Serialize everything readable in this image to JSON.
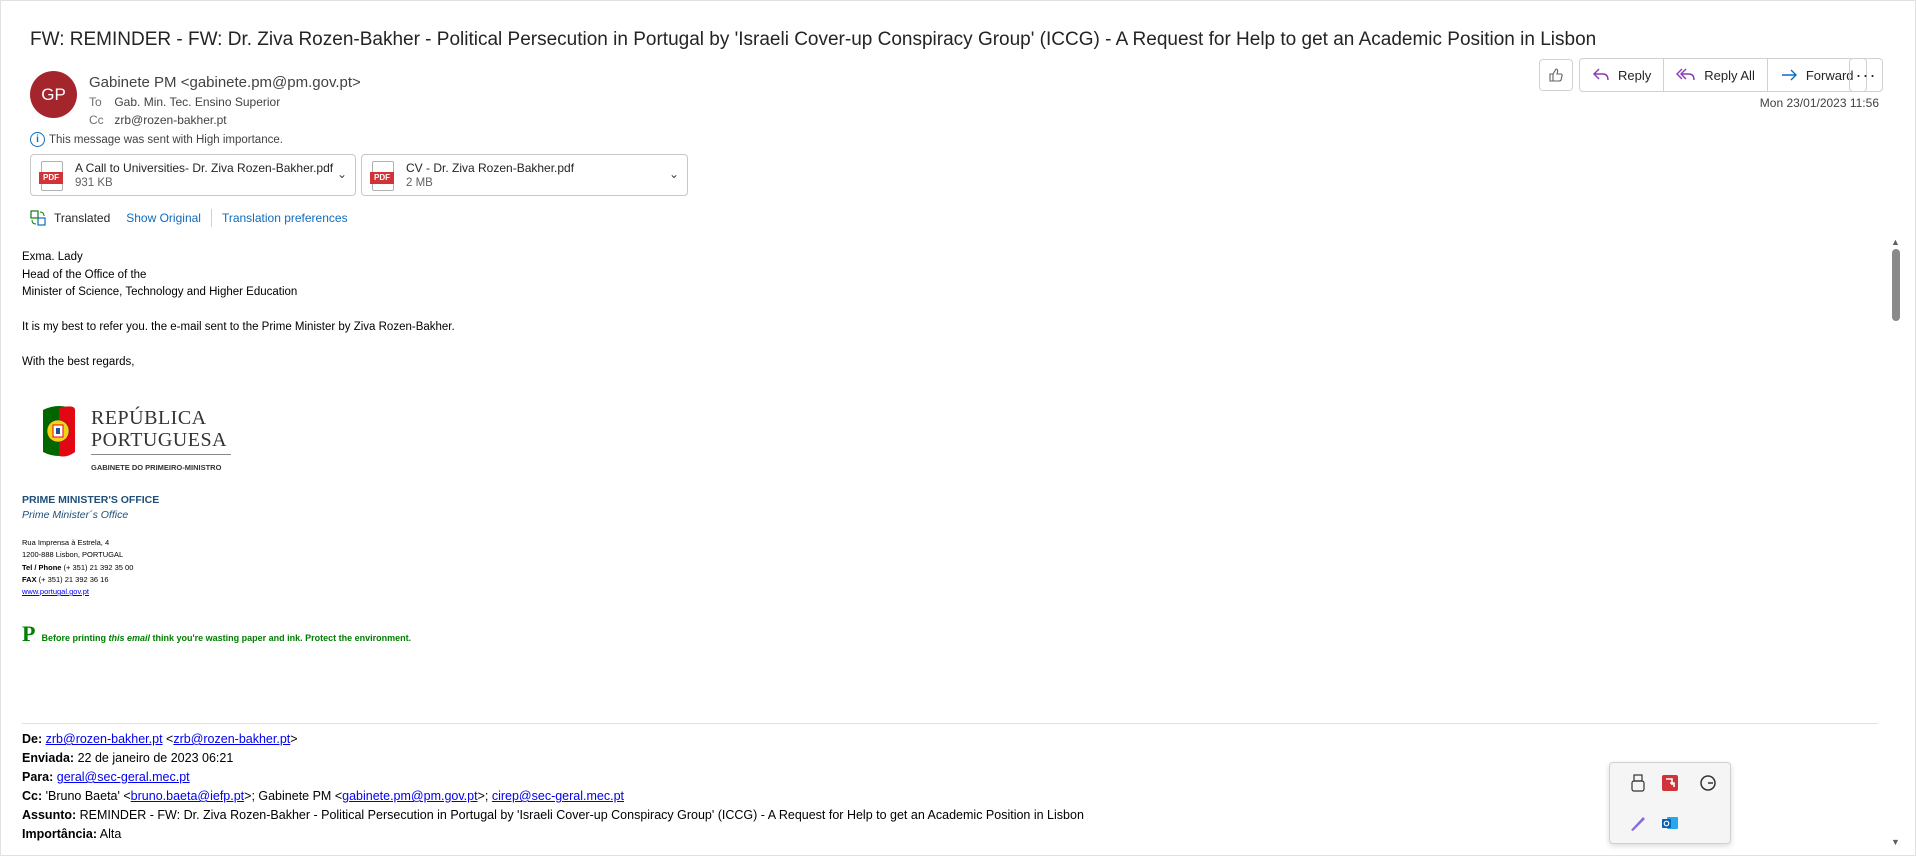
{
  "email": {
    "subject": "FW: REMINDER - FW: Dr. Ziva Rozen-Bakher - Political Persecution in Portugal by 'Israeli Cover-up Conspiracy Group' (ICCG) - A Request for Help to get an Academic Position in Lisbon",
    "avatar_initials": "GP",
    "avatar_color": "#a4262c",
    "sender": "Gabinete PM <gabinete.pm@pm.gov.pt>",
    "to_label": "To",
    "to": "Gab. Min. Tec. Ensino Superior",
    "cc_label": "Cc",
    "cc": "zrb@rozen-bakher.pt",
    "importance_note": "This message was sent with High importance.",
    "date": "Mon 23/01/2023 11:56"
  },
  "toolbar": {
    "reply": "Reply",
    "reply_all": "Reply All",
    "forward": "Forward",
    "more_icon": "more-horizontal-icon",
    "like_icon": "thumbs-up-icon"
  },
  "attachments": [
    {
      "name": "A Call to Universities- Dr. Ziva Rozen-Bakher.pdf",
      "size": "931 KB",
      "icon": "pdf-icon"
    },
    {
      "name": "CV - Dr. Ziva Rozen-Bakher.pdf",
      "size": "2 MB",
      "icon": "pdf-icon"
    }
  ],
  "translation": {
    "status": "Translated",
    "show_original": "Show Original",
    "preferences": "Translation preferences"
  },
  "body": {
    "greeting": "Exma. Lady",
    "line2": "Head of the Office of the",
    "line3": "Minister of Science, Technology and Higher Education",
    "message": "It is my best to refer you. the e-mail sent to the Prime Minister by Ziva Rozen-Bakher.",
    "closing": "With the best regards,"
  },
  "signature": {
    "logo_line1": "REPÚBLICA",
    "logo_line2": "PORTUGUESA",
    "logo_sub": "GABINETE DO PRIMEIRO-MINISTRO",
    "office": "PRIME MINISTER'S OFFICE",
    "office_sub": "Prime Minister´s Office",
    "address1": "Rua Imprensa à Estrela, 4",
    "address2": "1200-888 Lisbon, PORTUGAL",
    "tel_label": "Tel / Phone",
    "tel": " (+ 351) 21 392 35 00",
    "fax_label": "FAX",
    "fax": " (+ 351) 21 392 36 16",
    "website": "www.portugal.gov.pt",
    "eco_p": "P",
    "eco_pre": "Before printing ",
    "eco_em": "this email",
    "eco_post": "  think you're wasting paper and ink. Protect the environment."
  },
  "forwarded": {
    "de_label": "De:",
    "de_link1": "zrb@rozen-bakher.pt",
    "de_link2": "zrb@rozen-bakher.pt",
    "enviada_label": "Enviada:",
    "enviada": " 22 de janeiro de 2023 06:21",
    "para_label": "Para:",
    "para_link": "geral@sec-geral.mec.pt",
    "cc_label": "Cc:",
    "cc_text1": " 'Bruno Baeta' <",
    "cc_link1": "bruno.baeta@iefp.pt",
    "cc_text2": ">; Gabinete PM <",
    "cc_link2": "gabinete.pm@pm.gov.pt",
    "cc_text3": ">; ",
    "cc_link3": "cirep@sec-geral.mec.pt",
    "assunto_label": "Assunto:",
    "assunto": " REMINDER - FW: Dr. Ziva Rozen-Bakher - Political Persecution in Portugal by 'Israeli Cover-up Conspiracy Group' (ICCG) - A Request for Help to get an Academic Position in Lisbon",
    "importancia_label": "Importância:",
    "importancia": " Alta"
  },
  "tray": {
    "icons": [
      "usb-drive-icon",
      "pdf-app-icon",
      "grammarly-icon",
      "pen-icon",
      "outlook-icon"
    ]
  }
}
